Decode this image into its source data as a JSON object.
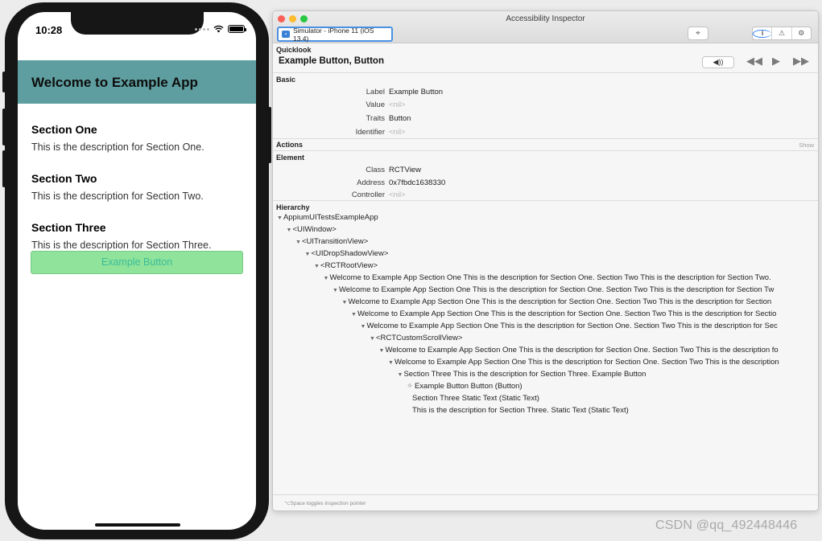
{
  "phone": {
    "status_time": "10:28",
    "app_title": "Welcome to Example App",
    "sections": [
      {
        "title": "Section One",
        "description": "This is the description for Section One."
      },
      {
        "title": "Section Two",
        "description": "This is the description for Section Two."
      },
      {
        "title": "Section Three",
        "description": "This is the description for Section Three."
      }
    ],
    "button_label": "Example Button",
    "colors": {
      "header": "#5f9ea0",
      "button": "#8fe39a",
      "button_text": "#3bbd9a"
    }
  },
  "inspector": {
    "window_title": "Accessibility Inspector",
    "target": "Simulator - iPhone 11 (iOS 13.4)",
    "quicklook": {
      "label": "Quicklook",
      "title": "Example Button, Button",
      "speaker": "◀))"
    },
    "basic": {
      "label": "Basic",
      "rows": [
        {
          "key": "Label",
          "value": "Example Button",
          "nil": false
        },
        {
          "key": "Value",
          "value": "<nil>",
          "nil": true
        },
        {
          "key": "Traits",
          "value": "Button",
          "nil": false
        },
        {
          "key": "Identifier",
          "value": "<nil>",
          "nil": true
        }
      ]
    },
    "actions": {
      "label": "Actions",
      "show": "Show"
    },
    "element": {
      "label": "Element",
      "rows": [
        {
          "key": "Class",
          "value": "RCTView",
          "nil": false
        },
        {
          "key": "Address",
          "value": "0x7fbdc1638330",
          "nil": false
        },
        {
          "key": "Controller",
          "value": "<nil>",
          "nil": true
        }
      ]
    },
    "hierarchy": {
      "label": "Hierarchy",
      "rows": [
        {
          "text": "AppiumUITestsExampleApp",
          "depth": 0,
          "marker": "tri"
        },
        {
          "text": "<UIWindow>",
          "depth": 1,
          "marker": "tri"
        },
        {
          "text": "<UITransitionView>",
          "depth": 2,
          "marker": "tri"
        },
        {
          "text": "<UIDropShadowView>",
          "depth": 3,
          "marker": "tri"
        },
        {
          "text": "<RCTRootView>",
          "depth": 4,
          "marker": "tri"
        },
        {
          "text": "Welcome to Example App Section One This is the description for Section One. Section Two This is the description for Section Two.",
          "depth": 5,
          "marker": "tri"
        },
        {
          "text": "Welcome to Example App Section One This is the description for Section One. Section Two This is the description for Section Tw",
          "depth": 6,
          "marker": "tri"
        },
        {
          "text": "Welcome to Example App Section One This is the description for Section One. Section Two This is the description for Section",
          "depth": 7,
          "marker": "tri"
        },
        {
          "text": "Welcome to Example App Section One This is the description for Section One. Section Two This is the description for Sectio",
          "depth": 8,
          "marker": "tri"
        },
        {
          "text": "Welcome to Example App Section One This is the description for Section One. Section Two This is the description for Sec",
          "depth": 9,
          "marker": "tri"
        },
        {
          "text": "<RCTCustomScrollView>",
          "depth": 10,
          "marker": "tri"
        },
        {
          "text": "Welcome to Example App Section One This is the description for Section One. Section Two This is the description fo",
          "depth": 11,
          "marker": "tri"
        },
        {
          "text": "Welcome to Example App Section One This is the description for Section One. Section Two This is the description",
          "depth": 12,
          "marker": "tri"
        },
        {
          "text": "Section Three This is the description for Section Three. Example Button",
          "depth": 13,
          "marker": "tri"
        },
        {
          "text": "Example Button Button (Button)",
          "depth": 14,
          "marker": "pin"
        },
        {
          "text": "Section Three Static Text (Static Text)",
          "depth": 14,
          "marker": "none"
        },
        {
          "text": "This is the description for Section Three. Static Text (Static Text)",
          "depth": 14,
          "marker": "none"
        }
      ]
    },
    "footer": "⌥Space toggles inspection pointer"
  },
  "watermark": "CSDN @qq_492448446"
}
